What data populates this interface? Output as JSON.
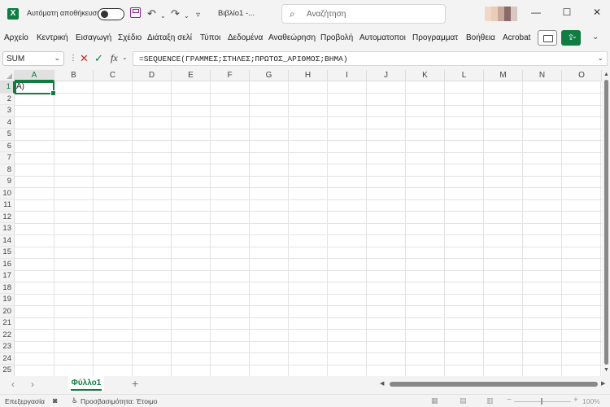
{
  "titlebar": {
    "app_icon_letter": "X",
    "autosave_label": "Αυτόματη αποθήκευση",
    "document_title": "Βιβλίο1  -...",
    "search_placeholder": "Αναζήτηση",
    "minimize": "—",
    "maximize": "☐",
    "close": "✕"
  },
  "ribbon": {
    "tabs": [
      "Αρχείο",
      "Κεντρική",
      "Εισαγωγή",
      "Σχέδιο",
      "Διάταξη σελί",
      "Τύποι",
      "Δεδομένα",
      "Αναθεώρηση",
      "Προβολή",
      "Αυτοματοποι",
      "Προγραμματ",
      "Βοήθεια",
      "Acrobat"
    ]
  },
  "formula_bar": {
    "name_box": "SUM",
    "fx_symbol": "fx",
    "formula": "=SEQUENCE(ΓΡΑΜΜΕΣ;ΣΤΗΛΕΣ;ΠΡΩΤΟΣ_ΑΡΙΘΜΟΣ;ΒΗΜΑ)"
  },
  "grid": {
    "columns": [
      "A",
      "B",
      "C",
      "D",
      "E",
      "F",
      "G",
      "H",
      "I",
      "J",
      "K",
      "L",
      "M",
      "N",
      "O"
    ],
    "rows": [
      "1",
      "2",
      "3",
      "4",
      "5",
      "6",
      "7",
      "8",
      "9",
      "10",
      "11",
      "12",
      "13",
      "14",
      "15",
      "16",
      "17",
      "18",
      "19",
      "20",
      "21",
      "22",
      "23",
      "24",
      "25"
    ],
    "active_cell_text": "A)"
  },
  "sheets": {
    "tabs": [
      "Φύλλο1"
    ],
    "add": "+"
  },
  "statusbar": {
    "mode": "Επεξεργασία",
    "accessibility": "Προσβασιμότητα: Έτοιμο",
    "zoom": "100%"
  },
  "colors": {
    "accent": "#107c41",
    "cancel": "#c42b1c"
  }
}
